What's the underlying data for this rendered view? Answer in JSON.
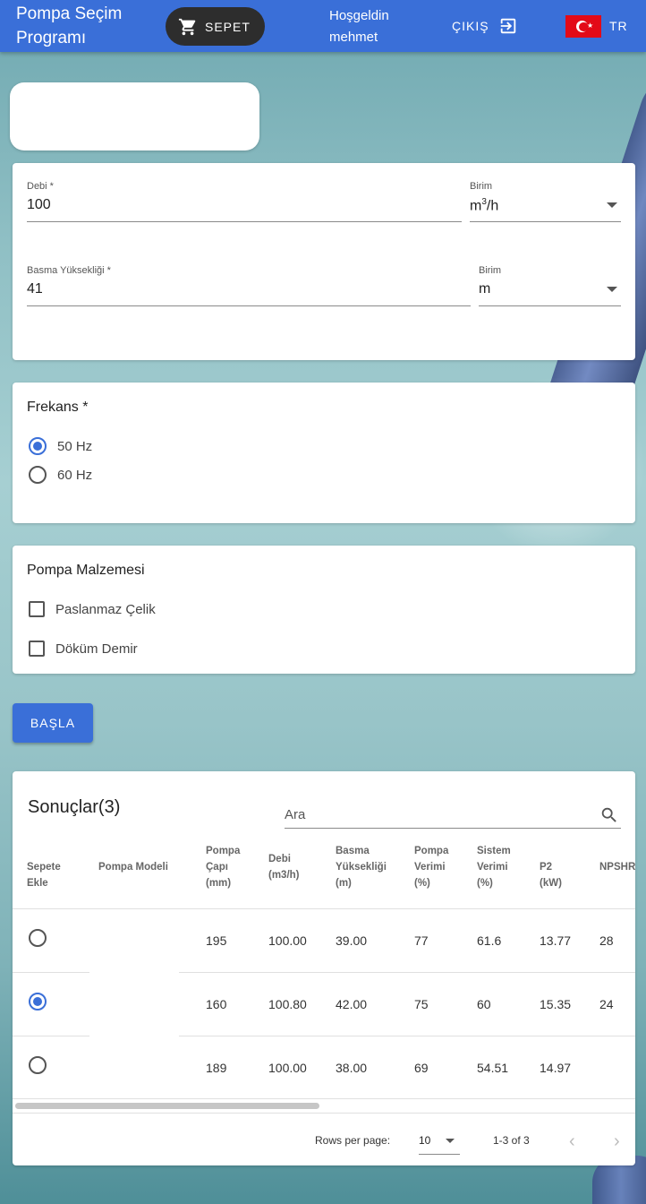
{
  "header": {
    "title": "Pompa Seçim Programı",
    "cart_label": "SEPET",
    "welcome_line1": "Hoşgeldin",
    "welcome_line2": "mehmet",
    "logout_label": "ÇIKIŞ",
    "language": "TR"
  },
  "form": {
    "flow": {
      "label": "Debi *",
      "value": "100",
      "unit_label": "Birim",
      "unit_value": "m",
      "unit_sup": "3",
      "unit_suffix": "/h"
    },
    "head": {
      "label": "Basma Yüksekliği *",
      "value": "41",
      "unit_label": "Birim",
      "unit_value": "m"
    }
  },
  "frequency": {
    "title": "Frekans *",
    "options": [
      {
        "label": "50 Hz",
        "selected": true
      },
      {
        "label": "60 Hz",
        "selected": false
      }
    ]
  },
  "material": {
    "title": "Pompa Malzemesi",
    "options": [
      {
        "label": "Paslanmaz Çelik",
        "checked": false
      },
      {
        "label": "Döküm Demir",
        "checked": false
      }
    ]
  },
  "start_button": "BAŞLA",
  "results": {
    "title": "Sonuçlar(3)",
    "search_placeholder": "Ara",
    "columns": [
      [
        "Sepete",
        "Ekle"
      ],
      [
        "Pompa Modeli"
      ],
      [
        "Pompa",
        "Çapı",
        "(mm)"
      ],
      [
        "Debi",
        "(m3/h)"
      ],
      [
        "Basma",
        "Yüksekliği",
        "(m)"
      ],
      [
        "Pompa",
        "Verimi",
        "(%)"
      ],
      [
        "Sistem",
        "Verimi",
        "(%)"
      ],
      [
        "P2",
        "(kW)"
      ],
      [
        "NPSHR"
      ]
    ],
    "rows": [
      {
        "selected": false,
        "model": "",
        "diameter": "195",
        "flow": "100.00",
        "head": "39.00",
        "pump_eff": "77",
        "sys_eff": "61.6",
        "p2": "13.77",
        "npshr": "28"
      },
      {
        "selected": true,
        "model": "",
        "diameter": "160",
        "flow": "100.80",
        "head": "42.00",
        "pump_eff": "75",
        "sys_eff": "60",
        "p2": "15.35",
        "npshr": "24"
      },
      {
        "selected": false,
        "model": "",
        "diameter": "189",
        "flow": "100.00",
        "head": "38.00",
        "pump_eff": "69",
        "sys_eff": "54.51",
        "p2": "14.97",
        "npshr": ""
      }
    ],
    "footer": {
      "rows_per_page_label": "Rows per page:",
      "rows_per_page": "10",
      "range": "1-3 of 3"
    }
  },
  "colors": {
    "primary": "#3a6fd8",
    "cart_bg": "#2d2d2d",
    "flag_red": "#e30a17"
  },
  "icons": {
    "cart": "cart-icon",
    "logout": "logout-icon",
    "search": "search-icon",
    "prev": "chevron-left-icon",
    "next": "chevron-right-icon"
  }
}
